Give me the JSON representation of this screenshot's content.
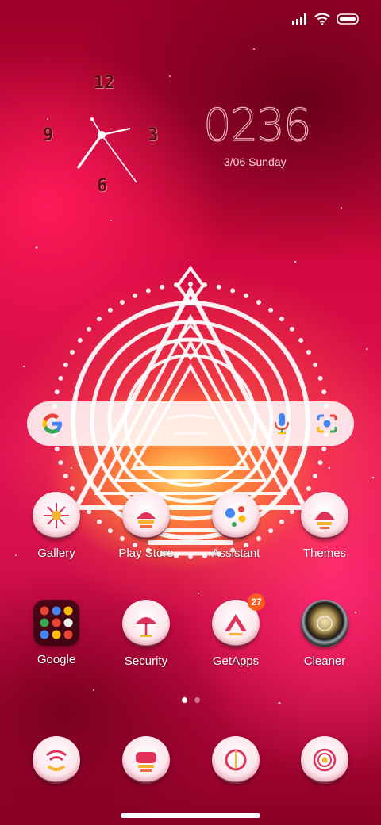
{
  "status_bar": {
    "icons": [
      "signal-icon",
      "wifi-icon",
      "battery-icon"
    ]
  },
  "analog_clock": {
    "numerals": [
      "12",
      "3",
      "6",
      "9"
    ]
  },
  "digital_clock": {
    "time": "0236",
    "date": "3/06 Sunday"
  },
  "search_widget": {
    "icons": [
      "google-g-icon",
      "microphone-icon",
      "lens-camera-icon"
    ]
  },
  "home_apps_row1": [
    {
      "label": "Gallery"
    },
    {
      "label": "Play Store"
    },
    {
      "label": "Assistant"
    },
    {
      "label": "Themes"
    }
  ],
  "home_apps_row2": [
    {
      "label": "Google"
    },
    {
      "label": "Security"
    },
    {
      "label": "GetApps",
      "badge": "27"
    },
    {
      "label": "Cleaner"
    }
  ],
  "page_indicator": {
    "pages": 2,
    "current": 1
  },
  "dock_icons": [
    "phone-icon",
    "messaging-icon",
    "browser-icon",
    "camera-icon"
  ],
  "colors": {
    "accent": "#e21454",
    "badge": "#ff5a1f",
    "text": "#ffffff"
  }
}
